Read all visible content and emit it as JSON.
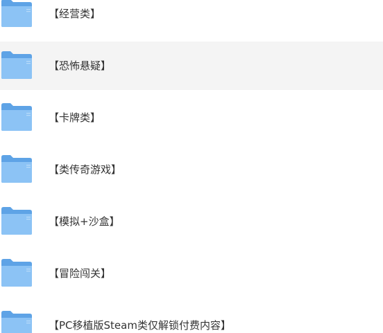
{
  "folders": [
    {
      "name": "【经营类】",
      "icon": "folder-icon"
    },
    {
      "name": "【恐怖悬疑】",
      "icon": "folder-icon",
      "hovered": true
    },
    {
      "name": "【卡牌类】",
      "icon": "folder-icon"
    },
    {
      "name": "【类传奇游戏】",
      "icon": "folder-icon"
    },
    {
      "name": "【模拟+沙盒】",
      "icon": "folder-icon"
    },
    {
      "name": "【冒险闯关】",
      "icon": "folder-icon"
    },
    {
      "name": "【PC移植版Steam类仅解锁付费内容】",
      "icon": "folder-icon"
    }
  ],
  "colors": {
    "folder_back": "#5ea3e6",
    "folder_front": "#8cc3f5",
    "hover_bg": "#f4f4f4",
    "text": "#333333"
  }
}
